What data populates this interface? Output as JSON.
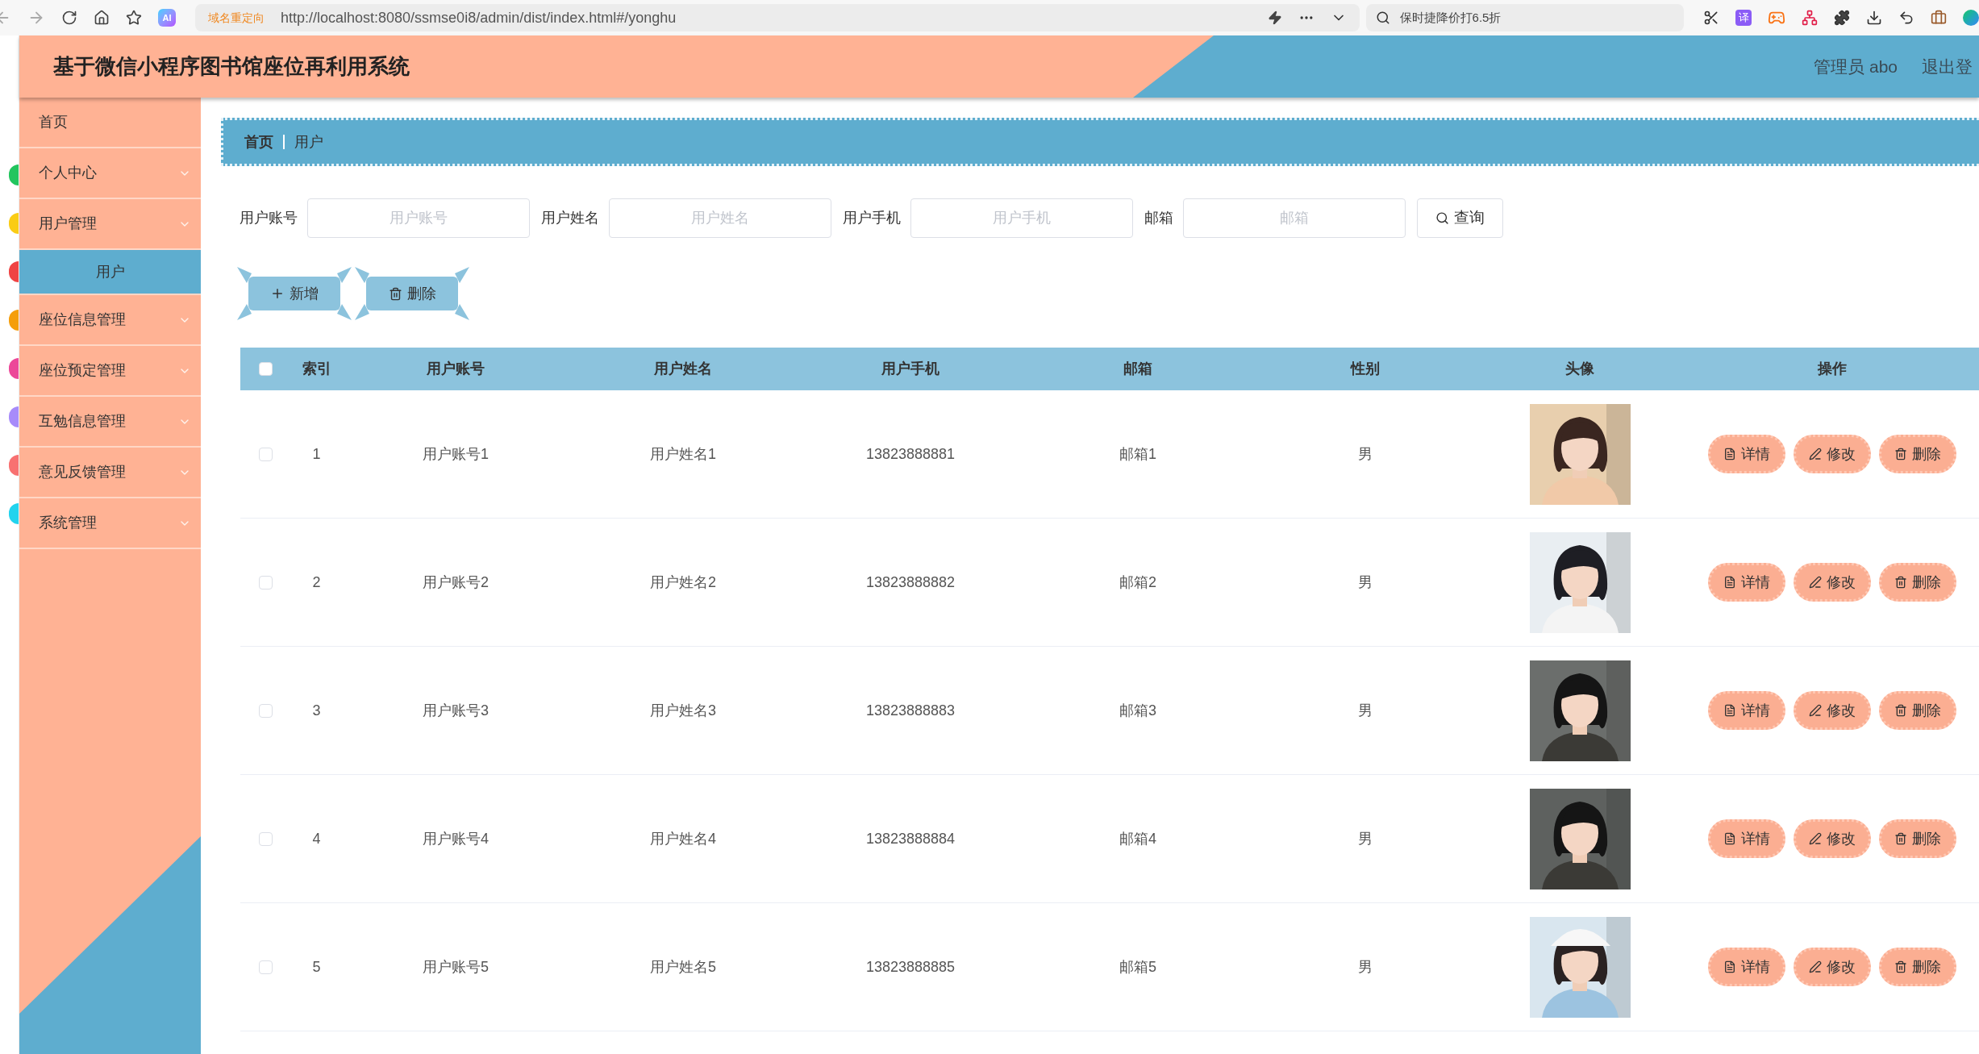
{
  "browser": {
    "ai_label": "AI",
    "url_badge": "域名重定向",
    "url": "http://localhost:8080/ssmse0i8/admin/dist/index.html#/yonghu",
    "search_text": "保时捷降价打6.5折",
    "translate_label": "译"
  },
  "header": {
    "title": "基于微信小程序图书馆座位再利用系统",
    "user": "管理员 abo",
    "logout": "退出登"
  },
  "sidebar": {
    "items": [
      {
        "label": "首页",
        "kind": "link",
        "selected": false
      },
      {
        "label": "个人中心",
        "kind": "menu",
        "selected": false
      },
      {
        "label": "用户管理",
        "kind": "menu",
        "selected": false,
        "children": [
          {
            "label": "用户",
            "selected": true
          }
        ]
      },
      {
        "label": "座位信息管理",
        "kind": "menu",
        "selected": false
      },
      {
        "label": "座位预定管理",
        "kind": "menu",
        "selected": false
      },
      {
        "label": "互勉信息管理",
        "kind": "menu",
        "selected": false
      },
      {
        "label": "意见反馈管理",
        "kind": "menu",
        "selected": false
      },
      {
        "label": "系统管理",
        "kind": "menu",
        "selected": false
      }
    ]
  },
  "breadcrumb": [
    "首页",
    "用户"
  ],
  "filters": [
    {
      "label": "用户账号",
      "placeholder": "用户账号"
    },
    {
      "label": "用户姓名",
      "placeholder": "用户姓名"
    },
    {
      "label": "用户手机",
      "placeholder": "用户手机"
    },
    {
      "label": "邮箱",
      "placeholder": "邮箱"
    }
  ],
  "search_button": "查询",
  "actions": [
    {
      "label": "新增",
      "kind": "add"
    },
    {
      "label": "删除",
      "kind": "delete"
    }
  ],
  "table": {
    "select_all": {
      "checked": false
    },
    "columns": [
      "索引",
      "用户账号",
      "用户姓名",
      "用户手机",
      "邮箱",
      "性别",
      "头像",
      "操作"
    ],
    "rows": [
      {
        "checked": false,
        "index": "1",
        "account": "用户账号1",
        "name": "用户姓名1",
        "phone": "13823888881",
        "email": "邮箱1",
        "gender": "男",
        "avatar": {
          "kind": "picture"
        },
        "actions": [
          {
            "label": "详情",
            "kind": "detail"
          },
          {
            "label": "修改",
            "kind": "edit"
          },
          {
            "label": "删除",
            "kind": "delete"
          }
        ]
      },
      {
        "checked": false,
        "index": "2",
        "account": "用户账号2",
        "name": "用户姓名2",
        "phone": "13823888882",
        "email": "邮箱2",
        "gender": "男",
        "avatar": {
          "kind": "picture"
        },
        "actions": [
          {
            "label": "详情",
            "kind": "detail"
          },
          {
            "label": "修改",
            "kind": "edit"
          },
          {
            "label": "删除",
            "kind": "delete"
          }
        ]
      },
      {
        "checked": false,
        "index": "3",
        "account": "用户账号3",
        "name": "用户姓名3",
        "phone": "13823888883",
        "email": "邮箱3",
        "gender": "男",
        "avatar": {
          "kind": "picture"
        },
        "actions": [
          {
            "label": "详情",
            "kind": "detail"
          },
          {
            "label": "修改",
            "kind": "edit"
          },
          {
            "label": "删除",
            "kind": "delete"
          }
        ]
      },
      {
        "checked": false,
        "index": "4",
        "account": "用户账号4",
        "name": "用户姓名4",
        "phone": "13823888884",
        "email": "邮箱4",
        "gender": "男",
        "avatar": {
          "kind": "picture"
        },
        "actions": [
          {
            "label": "详情",
            "kind": "detail"
          },
          {
            "label": "修改",
            "kind": "edit"
          },
          {
            "label": "删除",
            "kind": "delete"
          }
        ]
      },
      {
        "checked": false,
        "index": "5",
        "account": "用户账号5",
        "name": "用户姓名5",
        "phone": "13823888885",
        "email": "邮箱5",
        "gender": "男",
        "avatar": {
          "kind": "picture"
        },
        "actions": [
          {
            "label": "详情",
            "kind": "detail"
          },
          {
            "label": "修改",
            "kind": "edit"
          },
          {
            "label": "删除",
            "kind": "delete"
          }
        ]
      }
    ]
  }
}
